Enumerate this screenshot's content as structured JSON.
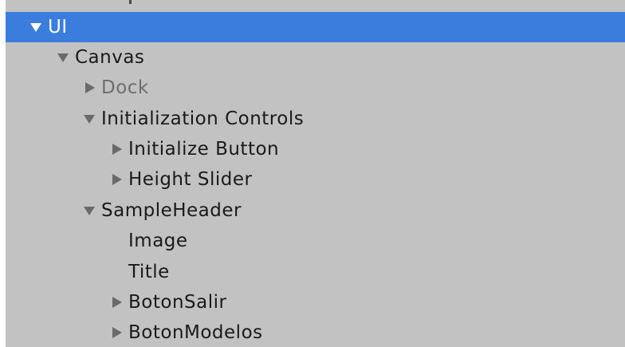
{
  "hierarchy": {
    "items": [
      {
        "label": "UI",
        "state": "expanded",
        "selected": true,
        "dim": false
      },
      {
        "label": "Canvas",
        "state": "expanded",
        "selected": false,
        "dim": false
      },
      {
        "label": "Dock",
        "state": "collapsed",
        "selected": false,
        "dim": true
      },
      {
        "label": "Initialization Controls",
        "state": "expanded",
        "selected": false,
        "dim": false
      },
      {
        "label": "Initialize Button",
        "state": "collapsed",
        "selected": false,
        "dim": false
      },
      {
        "label": "Height Slider",
        "state": "collapsed",
        "selected": false,
        "dim": false
      },
      {
        "label": "SampleHeader",
        "state": "expanded",
        "selected": false,
        "dim": false
      },
      {
        "label": "Image",
        "state": "leaf",
        "selected": false,
        "dim": false
      },
      {
        "label": "Title",
        "state": "leaf",
        "selected": false,
        "dim": false
      },
      {
        "label": "BotonSalir",
        "state": "collapsed",
        "selected": false,
        "dim": false
      },
      {
        "label": "BotonModelos",
        "state": "collapsed",
        "selected": false,
        "dim": false
      }
    ]
  },
  "colors": {
    "panel_bg": "#c2c2c2",
    "selection_bg": "#3a7ddc",
    "text": "#1a1a1a",
    "dim_text": "#6e6e6e",
    "arrow": "#6a6a6a"
  }
}
